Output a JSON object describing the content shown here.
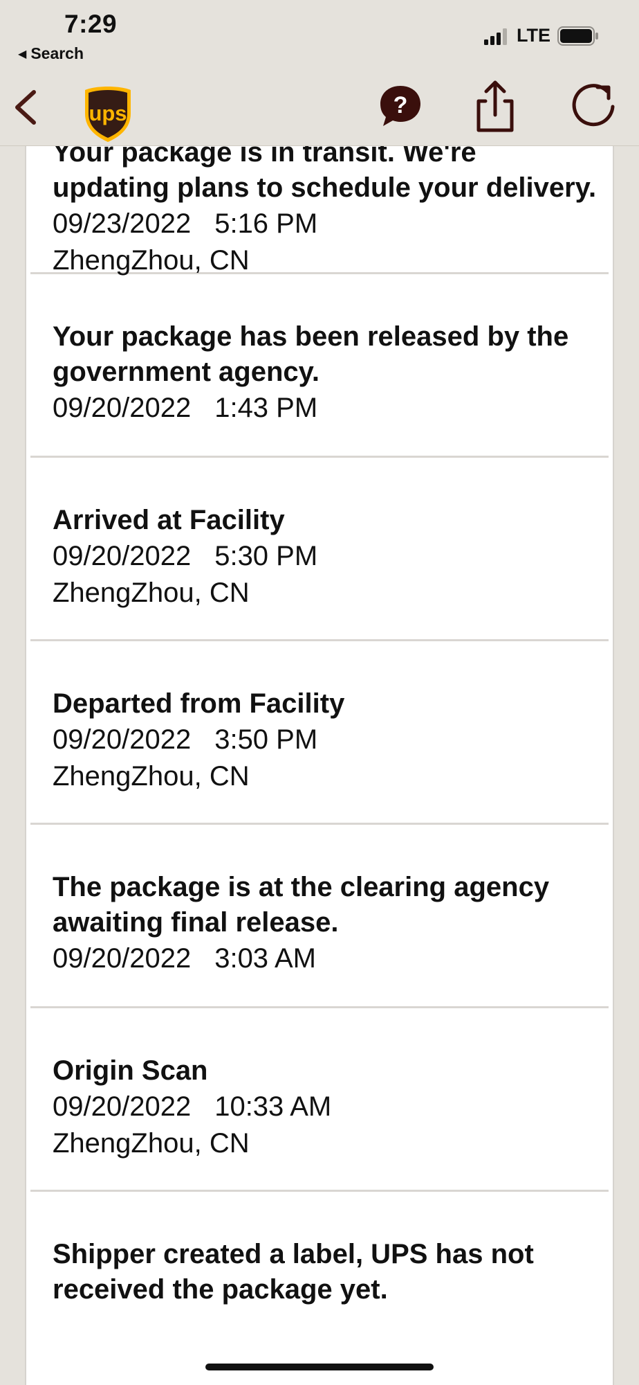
{
  "status_bar": {
    "time": "7:29",
    "back_app_label": "Search",
    "network": "LTE"
  },
  "nav": {
    "logo_text": "ups",
    "help_symbol": "?"
  },
  "colors": {
    "brand_brown": "#351c15",
    "brand_gold": "#ffb500",
    "chrome_bg": "#e5e2dc",
    "divider": "#d9d6d2"
  },
  "icons": {
    "back": "chevron-left-icon",
    "help": "question-bubble-icon",
    "share": "share-icon",
    "refresh": "refresh-icon"
  },
  "events": [
    {
      "description": "Your package is in transit. We're updating plans to schedule your delivery.",
      "date": "09/23/2022",
      "time": "5:16 PM",
      "location": "ZhengZhou, CN"
    },
    {
      "description": "Your package has been released by the government agency.",
      "date": "09/20/2022",
      "time": "1:43 PM",
      "location": ""
    },
    {
      "description": "Arrived at Facility",
      "date": "09/20/2022",
      "time": "5:30 PM",
      "location": "ZhengZhou, CN"
    },
    {
      "description": "Departed from Facility",
      "date": "09/20/2022",
      "time": "3:50 PM",
      "location": "ZhengZhou, CN"
    },
    {
      "description": "The package is at the clearing agency awaiting final release.",
      "date": "09/20/2022",
      "time": "3:03 AM",
      "location": ""
    },
    {
      "description": "Origin Scan",
      "date": "09/20/2022",
      "time": "10:33 AM",
      "location": "ZhengZhou, CN"
    },
    {
      "description": "Shipper created a label, UPS has not received the package yet.",
      "date": "",
      "time": "",
      "location": ""
    }
  ]
}
